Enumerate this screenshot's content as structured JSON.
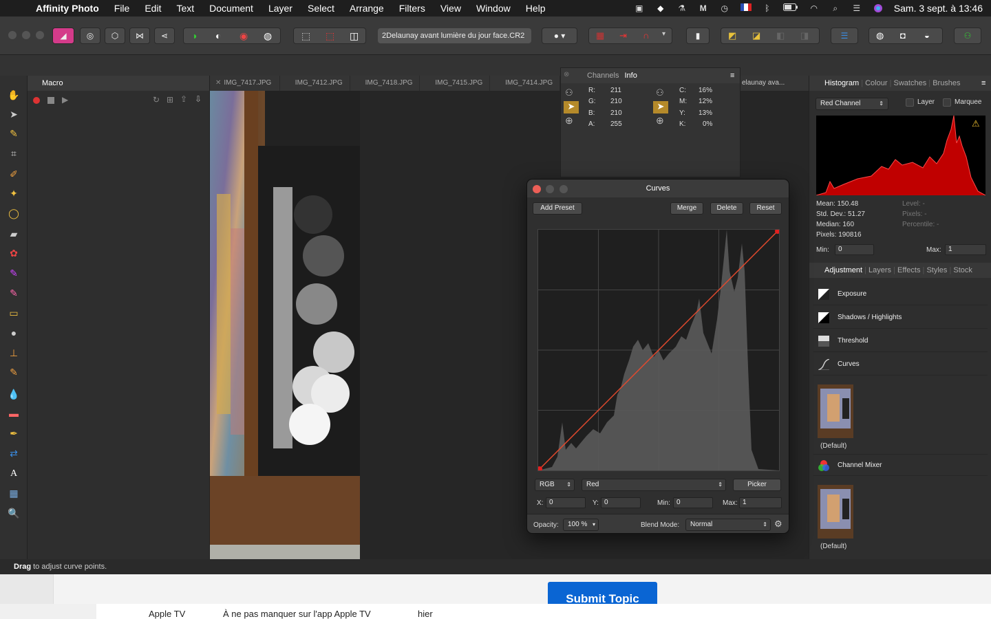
{
  "menubar": {
    "app_name": "Affinity Photo",
    "items": [
      "File",
      "Edit",
      "Text",
      "Document",
      "Layer",
      "Select",
      "Arrange",
      "Filters",
      "View",
      "Window",
      "Help"
    ],
    "clock": "Sam. 3 sept. à 13:46"
  },
  "toolbar": {
    "document_name": "2Delaunay avant lumière du jour face.CR2"
  },
  "macro_panel": {
    "title": "Macro"
  },
  "doc_tabs": [
    "IMG_7417.JPG",
    "IMG_7412.JPG",
    "IMG_7418.JPG",
    "IMG_7415.JPG",
    "IMG_7414.JPG"
  ],
  "doc_tab_partial": "elaunay ava...",
  "info_panel": {
    "tab_channels": "Channels",
    "tab_info": "Info",
    "rgb": [
      {
        "k": "R:",
        "v": "211"
      },
      {
        "k": "G:",
        "v": "210"
      },
      {
        "k": "B:",
        "v": "210"
      },
      {
        "k": "A:",
        "v": "255"
      }
    ],
    "cmyk": [
      {
        "k": "C:",
        "v": "16%"
      },
      {
        "k": "M:",
        "v": "12%"
      },
      {
        "k": "Y:",
        "v": "13%"
      },
      {
        "k": "K:",
        "v": "0%"
      }
    ]
  },
  "histogram_panel": {
    "tabs": [
      "Histogram",
      "Colour",
      "Swatches",
      "Brushes"
    ],
    "channel": "Red Channel",
    "layer_label": "Layer",
    "marquee_label": "Marquee",
    "stats_left": [
      "Mean: 150.48",
      "Std. Dev.: 51.27",
      "Median: 160",
      "Pixels: 190816"
    ],
    "stats_right": [
      "Level: -",
      "Pixels: -",
      "Percentile: -"
    ],
    "min_label": "Min:",
    "min_value": "0",
    "max_label": "Max:",
    "max_value": "1"
  },
  "adjustment_panel": {
    "tabs": [
      "Adjustment",
      "Layers",
      "Effects",
      "Styles",
      "Stock"
    ],
    "items": [
      "Exposure",
      "Shadows / Highlights",
      "Threshold",
      "Curves",
      "Channel Mixer"
    ],
    "preset_label": "(Default)"
  },
  "curves_dialog": {
    "title": "Curves",
    "add_preset": "Add Preset",
    "merge": "Merge",
    "delete": "Delete",
    "reset": "Reset",
    "mode": "RGB",
    "channel": "Red",
    "picker": "Picker",
    "x_label": "X:",
    "x_value": "0",
    "y_label": "Y:",
    "y_value": "0",
    "min_label": "Min:",
    "min_value": "0",
    "max_label": "Max:",
    "max_value": "1",
    "opacity_label": "Opacity:",
    "opacity_value": "100 %",
    "blend_label": "Blend Mode:",
    "blend_value": "Normal"
  },
  "status_bar": {
    "strong": "Drag",
    "text": " to adjust curve points."
  },
  "background_page": {
    "submit": "Submit Topic",
    "row": [
      "Apple TV",
      "À ne pas manquer sur l'app Apple TV",
      "hier"
    ]
  }
}
